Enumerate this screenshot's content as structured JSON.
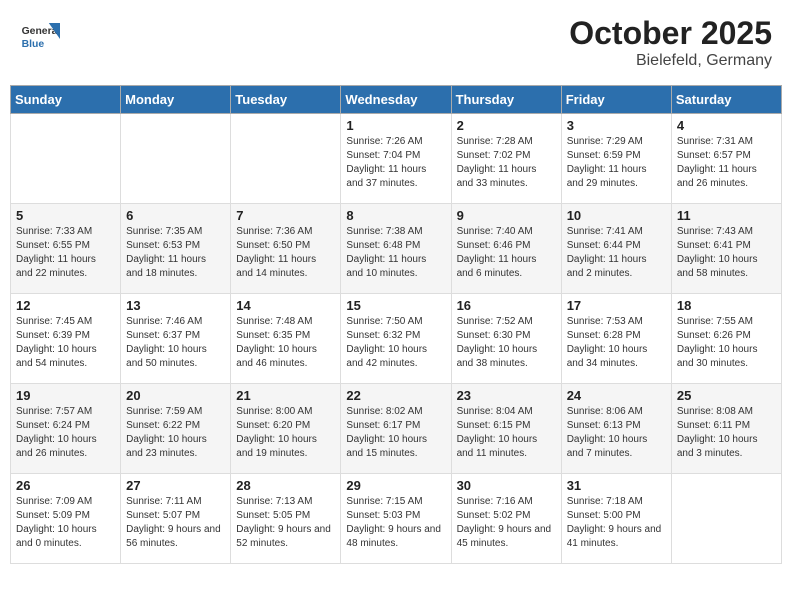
{
  "header": {
    "title": "October 2025",
    "subtitle": "Bielefeld, Germany"
  },
  "logo": {
    "general": "General",
    "blue": "Blue"
  },
  "weekdays": [
    "Sunday",
    "Monday",
    "Tuesday",
    "Wednesday",
    "Thursday",
    "Friday",
    "Saturday"
  ],
  "rows": [
    [
      {
        "day": "",
        "info": ""
      },
      {
        "day": "",
        "info": ""
      },
      {
        "day": "",
        "info": ""
      },
      {
        "day": "1",
        "info": "Sunrise: 7:26 AM\nSunset: 7:04 PM\nDaylight: 11 hours and 37 minutes."
      },
      {
        "day": "2",
        "info": "Sunrise: 7:28 AM\nSunset: 7:02 PM\nDaylight: 11 hours and 33 minutes."
      },
      {
        "day": "3",
        "info": "Sunrise: 7:29 AM\nSunset: 6:59 PM\nDaylight: 11 hours and 29 minutes."
      },
      {
        "day": "4",
        "info": "Sunrise: 7:31 AM\nSunset: 6:57 PM\nDaylight: 11 hours and 26 minutes."
      }
    ],
    [
      {
        "day": "5",
        "info": "Sunrise: 7:33 AM\nSunset: 6:55 PM\nDaylight: 11 hours and 22 minutes."
      },
      {
        "day": "6",
        "info": "Sunrise: 7:35 AM\nSunset: 6:53 PM\nDaylight: 11 hours and 18 minutes."
      },
      {
        "day": "7",
        "info": "Sunrise: 7:36 AM\nSunset: 6:50 PM\nDaylight: 11 hours and 14 minutes."
      },
      {
        "day": "8",
        "info": "Sunrise: 7:38 AM\nSunset: 6:48 PM\nDaylight: 11 hours and 10 minutes."
      },
      {
        "day": "9",
        "info": "Sunrise: 7:40 AM\nSunset: 6:46 PM\nDaylight: 11 hours and 6 minutes."
      },
      {
        "day": "10",
        "info": "Sunrise: 7:41 AM\nSunset: 6:44 PM\nDaylight: 11 hours and 2 minutes."
      },
      {
        "day": "11",
        "info": "Sunrise: 7:43 AM\nSunset: 6:41 PM\nDaylight: 10 hours and 58 minutes."
      }
    ],
    [
      {
        "day": "12",
        "info": "Sunrise: 7:45 AM\nSunset: 6:39 PM\nDaylight: 10 hours and 54 minutes."
      },
      {
        "day": "13",
        "info": "Sunrise: 7:46 AM\nSunset: 6:37 PM\nDaylight: 10 hours and 50 minutes."
      },
      {
        "day": "14",
        "info": "Sunrise: 7:48 AM\nSunset: 6:35 PM\nDaylight: 10 hours and 46 minutes."
      },
      {
        "day": "15",
        "info": "Sunrise: 7:50 AM\nSunset: 6:32 PM\nDaylight: 10 hours and 42 minutes."
      },
      {
        "day": "16",
        "info": "Sunrise: 7:52 AM\nSunset: 6:30 PM\nDaylight: 10 hours and 38 minutes."
      },
      {
        "day": "17",
        "info": "Sunrise: 7:53 AM\nSunset: 6:28 PM\nDaylight: 10 hours and 34 minutes."
      },
      {
        "day": "18",
        "info": "Sunrise: 7:55 AM\nSunset: 6:26 PM\nDaylight: 10 hours and 30 minutes."
      }
    ],
    [
      {
        "day": "19",
        "info": "Sunrise: 7:57 AM\nSunset: 6:24 PM\nDaylight: 10 hours and 26 minutes."
      },
      {
        "day": "20",
        "info": "Sunrise: 7:59 AM\nSunset: 6:22 PM\nDaylight: 10 hours and 23 minutes."
      },
      {
        "day": "21",
        "info": "Sunrise: 8:00 AM\nSunset: 6:20 PM\nDaylight: 10 hours and 19 minutes."
      },
      {
        "day": "22",
        "info": "Sunrise: 8:02 AM\nSunset: 6:17 PM\nDaylight: 10 hours and 15 minutes."
      },
      {
        "day": "23",
        "info": "Sunrise: 8:04 AM\nSunset: 6:15 PM\nDaylight: 10 hours and 11 minutes."
      },
      {
        "day": "24",
        "info": "Sunrise: 8:06 AM\nSunset: 6:13 PM\nDaylight: 10 hours and 7 minutes."
      },
      {
        "day": "25",
        "info": "Sunrise: 8:08 AM\nSunset: 6:11 PM\nDaylight: 10 hours and 3 minutes."
      }
    ],
    [
      {
        "day": "26",
        "info": "Sunrise: 7:09 AM\nSunset: 5:09 PM\nDaylight: 10 hours and 0 minutes."
      },
      {
        "day": "27",
        "info": "Sunrise: 7:11 AM\nSunset: 5:07 PM\nDaylight: 9 hours and 56 minutes."
      },
      {
        "day": "28",
        "info": "Sunrise: 7:13 AM\nSunset: 5:05 PM\nDaylight: 9 hours and 52 minutes."
      },
      {
        "day": "29",
        "info": "Sunrise: 7:15 AM\nSunset: 5:03 PM\nDaylight: 9 hours and 48 minutes."
      },
      {
        "day": "30",
        "info": "Sunrise: 7:16 AM\nSunset: 5:02 PM\nDaylight: 9 hours and 45 minutes."
      },
      {
        "day": "31",
        "info": "Sunrise: 7:18 AM\nSunset: 5:00 PM\nDaylight: 9 hours and 41 minutes."
      },
      {
        "day": "",
        "info": ""
      }
    ]
  ]
}
